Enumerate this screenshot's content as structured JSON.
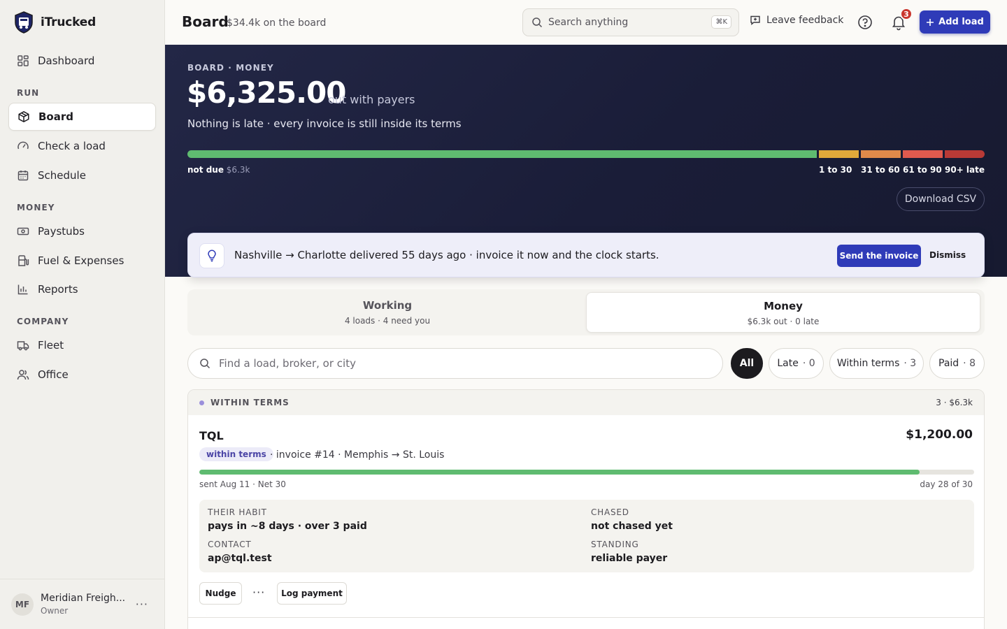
{
  "app": {
    "name": "iTrucked"
  },
  "sidebar": {
    "items": [
      {
        "label": "Dashboard",
        "icon": "dashboard-icon"
      },
      {
        "label": "Board",
        "icon": "box-icon",
        "active": true
      },
      {
        "label": "Check a load",
        "icon": "gauge-icon"
      },
      {
        "label": "Schedule",
        "icon": "calendar-icon"
      },
      {
        "label": "Paystubs",
        "icon": "banknote-icon"
      },
      {
        "label": "Fuel & Expenses",
        "icon": "fuel-icon"
      },
      {
        "label": "Reports",
        "icon": "bar-chart-icon"
      },
      {
        "label": "Fleet",
        "icon": "truck-icon"
      },
      {
        "label": "Office",
        "icon": "users-icon"
      }
    ],
    "sections": {
      "run": "RUN",
      "money": "MONEY",
      "company": "COMPANY"
    },
    "footer": {
      "initials": "MF",
      "org": "Meridian Freigh...",
      "role": "Owner"
    }
  },
  "header": {
    "title": "Board",
    "subtitle": "$34.4k on the board",
    "search_placeholder": "Search anything",
    "search_shortcut": "⌘K",
    "feedback": "Leave feedback",
    "notification_count": "3",
    "add_load": "Add load"
  },
  "hero": {
    "eyebrow": "BOARD · MONEY",
    "amount": "$6,325.00",
    "amount_suffix": "out with payers",
    "note": "Nothing is late · every invoice is still inside its terms",
    "aging": [
      {
        "label": "not due",
        "value": "$6.3k",
        "color": "#5fbb70",
        "share": 0.79
      },
      {
        "label": "1 to 30",
        "value": "",
        "color": "#e0a93a",
        "share": 0.05
      },
      {
        "label": "31 to 60",
        "value": "",
        "color": "#e08a4a",
        "share": 0.05
      },
      {
        "label": "61 to 90",
        "value": "",
        "color": "#e05a4e",
        "share": 0.05
      },
      {
        "label": "90+ late",
        "value": "",
        "color": "#b83a36",
        "share": 0.05
      }
    ],
    "download": "Download CSV"
  },
  "hint": {
    "text": "Nashville → Charlotte delivered 55 days ago · invoice it now and the clock starts.",
    "send": "Send the invoice",
    "dismiss": "Dismiss"
  },
  "tabs": [
    {
      "title": "Working",
      "sub": "4 loads · 4 need you"
    },
    {
      "title": "Money",
      "sub": "$6.3k out · 0 late",
      "active": true
    }
  ],
  "filters": {
    "placeholder": "Find a load, broker, or city",
    "chips": [
      {
        "label": "All",
        "count": ""
      },
      {
        "label": "Late",
        "count": "· 0"
      },
      {
        "label": "Within terms",
        "count": "· 3"
      },
      {
        "label": "Paid",
        "count": "· 8"
      }
    ]
  },
  "group": {
    "title": "WITHIN TERMS",
    "summary": "3 · $6.3k",
    "invoice": {
      "broker": "TQL",
      "amount": "$1,200.00",
      "status": "within terms",
      "meta": "· invoice #14  · Memphis → St. Louis",
      "sent": "sent Aug 11 · Net 30",
      "progress_text": "day 28 of 30",
      "progress": 0.93,
      "details": {
        "habit_label": "THEIR HABIT",
        "habit": "pays in ~8 days · over 3 paid",
        "chased_label": "CHASED",
        "chased": "not chased yet",
        "contact_label": "CONTACT",
        "contact": "ap@tql.test",
        "standing_label": "STANDING",
        "standing": "reliable payer"
      },
      "actions": {
        "nudge": "Nudge",
        "more": "···",
        "log": "Log payment"
      }
    }
  }
}
